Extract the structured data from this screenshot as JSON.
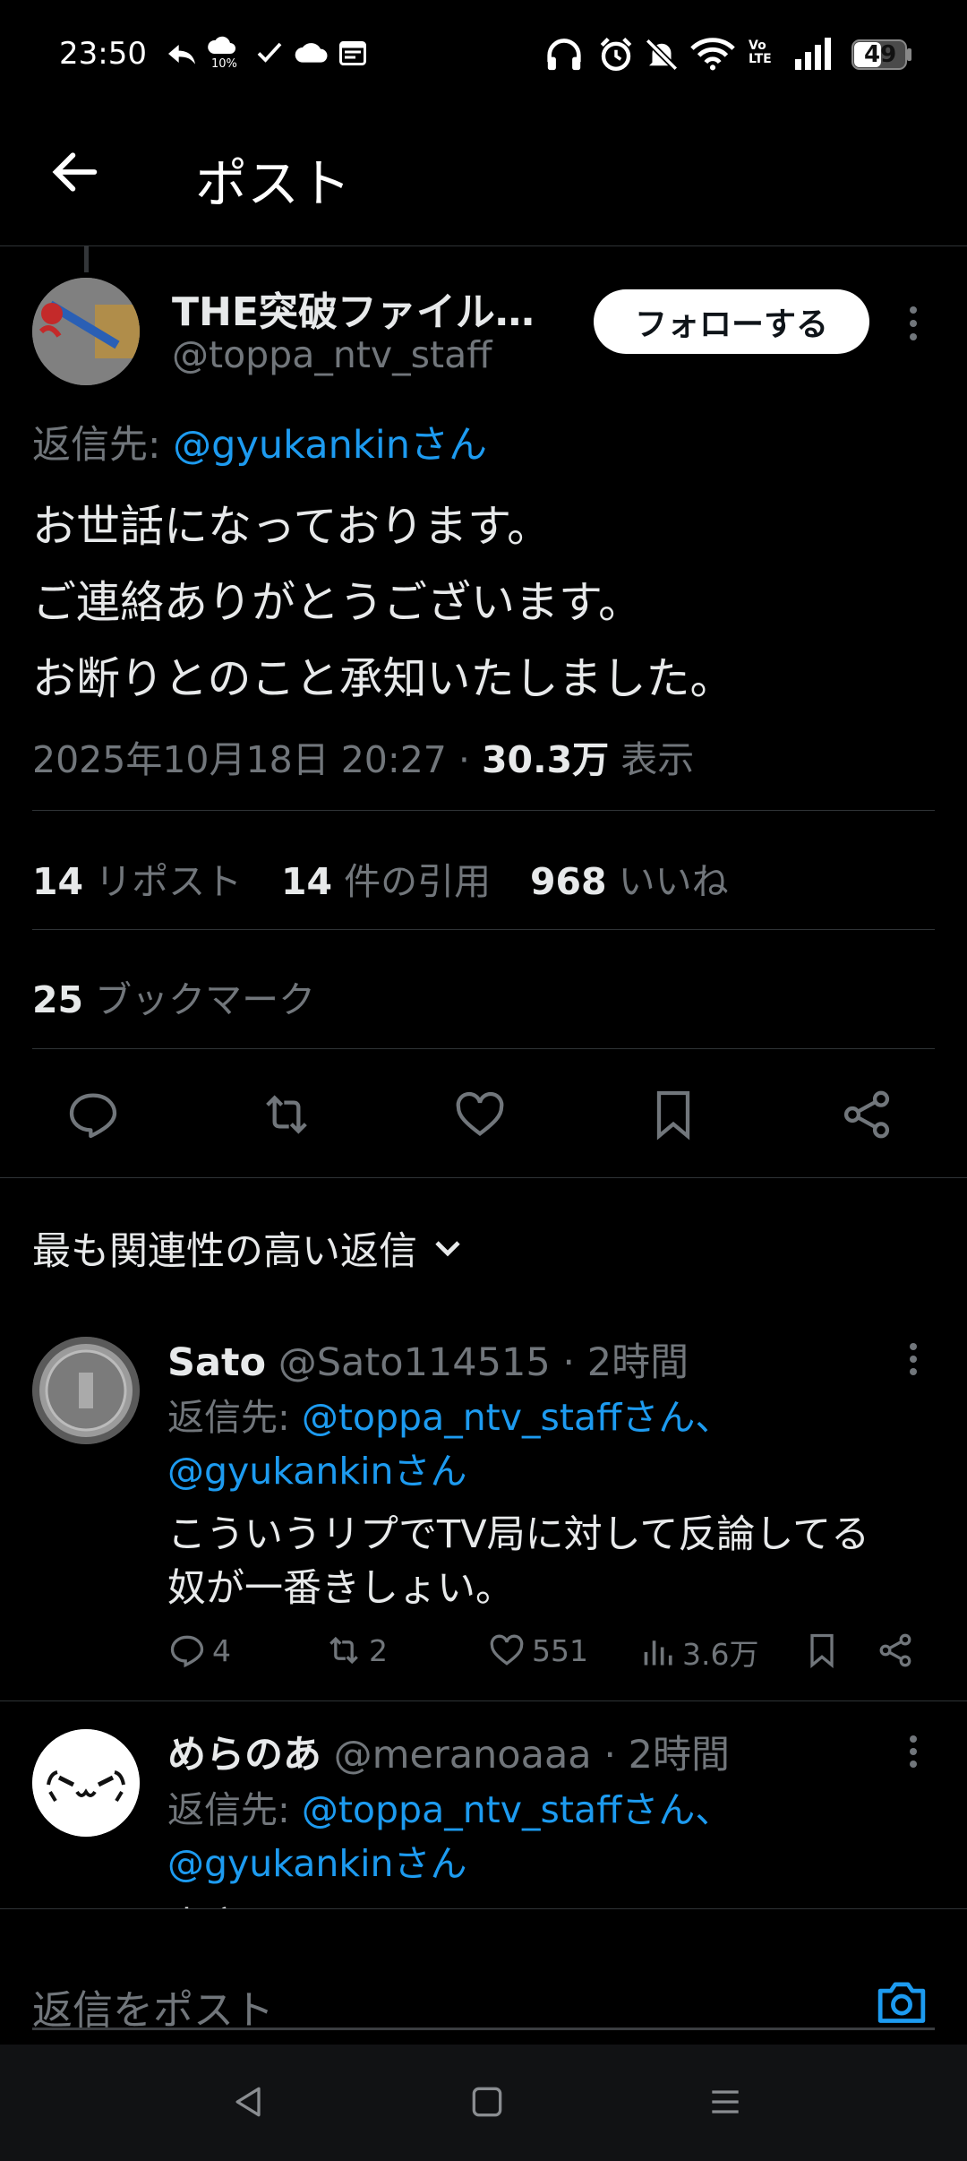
{
  "status_bar": {
    "time": "23:50",
    "battery": "49",
    "left_icons": [
      "reply-arrow-icon",
      "weather-icon",
      "check-icon",
      "cloud-icon",
      "calendar-icon"
    ],
    "right_icons": [
      "headphones-icon",
      "alarm-icon",
      "bell-muted-icon",
      "wifi-icon",
      "volte-icon",
      "signal-icon",
      "battery-icon"
    ],
    "volte_label": "Vo LTE",
    "rain_label": "10%"
  },
  "header": {
    "title": "ポスト"
  },
  "tweet": {
    "display_name": "THE突破ファイル…",
    "handle": "@toppa_ntv_staff",
    "follow_label": "フォローする",
    "reply_to_prefix": "返信先: ",
    "reply_to_user": "@gyukankin",
    "reply_to_suffix": "さん",
    "body_lines": [
      "お世話になっております。",
      "ご連絡ありがとうございます。",
      "お断りとのこと承知いたしました。"
    ],
    "timestamp": "2025年10月18日 20:27",
    "dot": "·",
    "views_count": "30.3万",
    "views_label": "表示",
    "reposts_count": "14",
    "reposts_label": "リポスト",
    "quotes_count": "14",
    "quotes_label": "件の引用",
    "likes_count": "968",
    "likes_label": "いいね",
    "bookmarks_count": "25",
    "bookmarks_label": "ブックマーク"
  },
  "replies_sort": {
    "label": "最も関連性の高い返信"
  },
  "replies": [
    {
      "name": "Sato",
      "handle": "@Sato114515",
      "time": "· 2時間",
      "reply_prefix": "返信先: ",
      "reply_users_line1": "@toppa_ntv_staffさん、",
      "reply_users_line2": "@gyukankinさん",
      "text_lines": [
        "こういうリプでTV局に対して反論してる",
        "奴が一番きしょい。"
      ],
      "replies": "4",
      "reposts": "2",
      "likes": "551",
      "views": "3.6万"
    },
    {
      "name": "めらのあ",
      "handle": "@meranoaaa",
      "time": "· 2時間",
      "reply_prefix": "返信先: ",
      "reply_users_line1": "@toppa_ntv_staffさん、",
      "reply_users_line2": "@gyukankinさん",
      "text_partial": "本家"
    }
  ],
  "composer": {
    "placeholder": "返信をポスト"
  },
  "colors": {
    "accent": "#1d9bf0",
    "background": "#000000",
    "muted": "#71767b",
    "text": "#e7e9ea",
    "divider": "#2f3336"
  }
}
